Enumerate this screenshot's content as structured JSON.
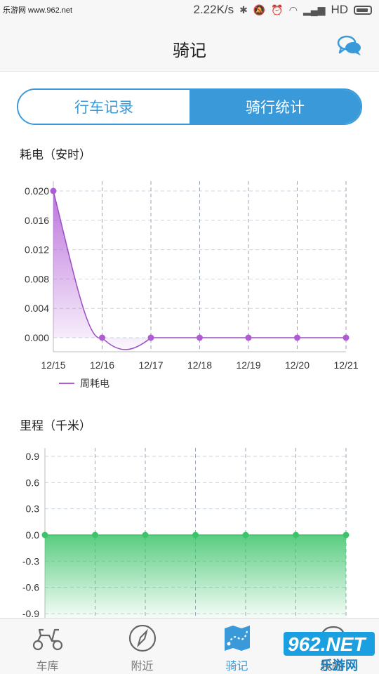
{
  "status_bar": {
    "watermark": "乐游网 www.962.net",
    "speed": "2.22K/s",
    "network": "HD"
  },
  "header": {
    "title": "骑记",
    "chat_icon": "chat-bubbles-icon"
  },
  "tabs": [
    {
      "label": "行车记录",
      "active": false
    },
    {
      "label": "骑行统计",
      "active": true
    }
  ],
  "charts": {
    "energy_title": "耗电（安时）",
    "mileage_title": "里程（千米）"
  },
  "chart_data": [
    {
      "type": "area",
      "title": "耗电（安时）",
      "categories": [
        "12/15",
        "12/16",
        "12/17",
        "12/18",
        "12/19",
        "12/20",
        "12/21"
      ],
      "series": [
        {
          "name": "周耗电",
          "values": [
            0.02,
            0.0,
            0.0,
            0.0,
            0.0,
            0.0,
            0.0
          ]
        }
      ],
      "yticks": [
        "0.020",
        "0.016",
        "0.012",
        "0.008",
        "0.004",
        "0.000"
      ],
      "ylim": [
        0,
        0.02
      ],
      "color": "#b05bd6",
      "grid": true,
      "legend": "bottom-left"
    },
    {
      "type": "area",
      "title": "里程（千米）",
      "series": [
        {
          "values": [
            0,
            0,
            0,
            0,
            0,
            0,
            0
          ]
        }
      ],
      "yticks": [
        "0.9",
        "0.6",
        "0.3",
        "0.0",
        "-0.3",
        "-0.6",
        "-0.9"
      ],
      "ylim": [
        -0.9,
        0.9
      ],
      "color": "#3cc46a",
      "grid": true
    }
  ],
  "bottom_nav": [
    {
      "label": "车库",
      "icon": "scooter-icon",
      "active": false
    },
    {
      "label": "附近",
      "icon": "compass-icon",
      "active": false
    },
    {
      "label": "骑记",
      "icon": "map-route-icon",
      "active": true
    },
    {
      "label": "我的",
      "icon": "helmet-icon",
      "active": false
    }
  ],
  "overlay_watermark": {
    "brand": "962.NET",
    "text": "乐游网"
  },
  "colors": {
    "accent": "#3a9ad9",
    "energy": "#b05bd6",
    "mileage": "#3cc46a"
  }
}
